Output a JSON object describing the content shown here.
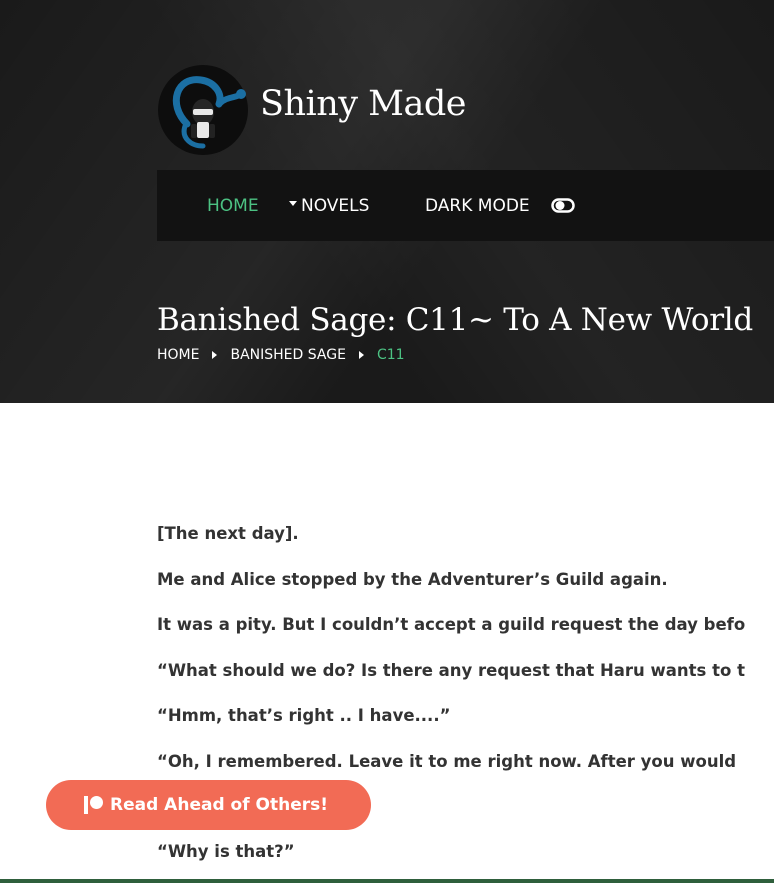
{
  "site": {
    "title": "Shiny Made"
  },
  "nav": {
    "home": "HOME",
    "novels": "NOVELS",
    "dark_mode": "DARK MODE"
  },
  "page": {
    "title": "Banished Sage: C11~ To A New World"
  },
  "breadcrumb": {
    "items": [
      "HOME",
      "BANISHED SAGE",
      "C11"
    ]
  },
  "content": {
    "paragraphs": [
      "[The next day].",
      "Me and Alice stopped by the Adventurer’s Guild again.",
      "It was a pity. But I couldn’t accept a guild request the day befo",
      "“What should we do? Is there any request that Haru wants to t",
      "“Hmm, that’s right .. I have....”",
      "“Oh, I remembered. Leave it to me right now. After you would"
    ],
    "last_paragraph": "“Why is that?”"
  },
  "cta": {
    "label": "Read Ahead of Others!"
  },
  "colors": {
    "accent_green": "#4cc283",
    "cta_coral": "#f26b55",
    "hero_bg": "#1a1a1a",
    "navbar_bg": "#121212"
  },
  "icons": {
    "logo": "ninja-snake-logo",
    "toggle": "toggle-switch-icon",
    "caret": "caret-down-icon",
    "separator": "chevron-right-icon",
    "patreon": "patreon-icon"
  }
}
